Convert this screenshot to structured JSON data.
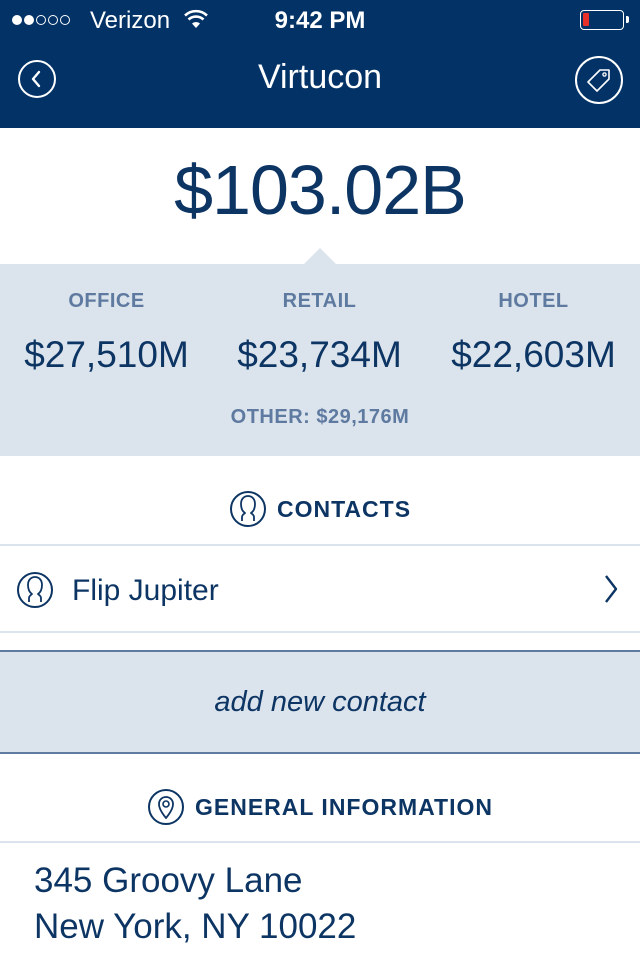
{
  "status_bar": {
    "signal_filled": 2,
    "signal_total": 5,
    "carrier": "Verizon",
    "time": "9:42 PM",
    "battery_level_percent": 10
  },
  "nav": {
    "title": "Virtucon",
    "back_icon": "chevron-left-circle-icon",
    "tag_icon": "tag-icon"
  },
  "summary": {
    "total": "$103.02B",
    "categories": [
      {
        "label": "OFFICE",
        "value": "$27,510M"
      },
      {
        "label": "RETAIL",
        "value": "$23,734M"
      },
      {
        "label": "HOTEL",
        "value": "$22,603M"
      }
    ],
    "other": "OTHER: $29,176M"
  },
  "contacts": {
    "heading": "CONTACTS",
    "items": [
      {
        "name": "Flip Jupiter"
      }
    ],
    "add_label": "add new contact"
  },
  "general_info": {
    "heading": "GENERAL INFORMATION",
    "address_line1": "345 Groovy Lane",
    "address_line2": "New York, NY 10022"
  },
  "colors": {
    "navy": "#033366",
    "text": "#0d3564",
    "panel": "#dbe3ec",
    "muted": "#5e7aa0",
    "battery_low": "#e8302a"
  }
}
